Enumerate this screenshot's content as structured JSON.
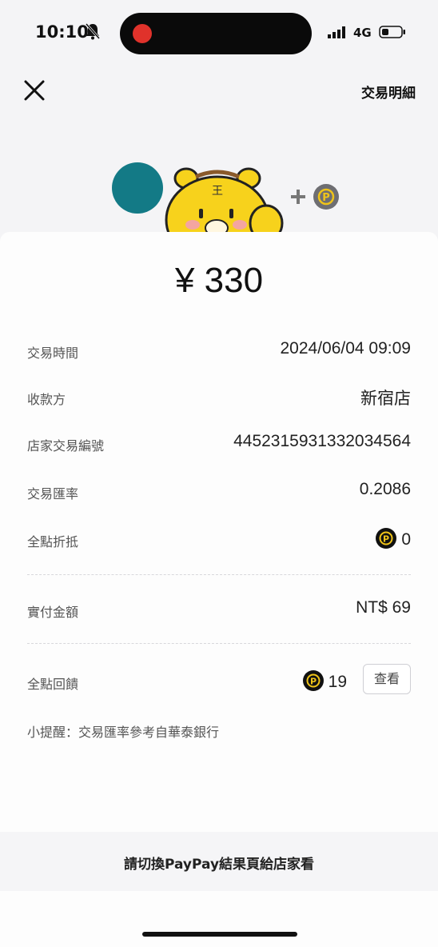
{
  "status_bar": {
    "time": "10:10",
    "network": "4G",
    "icons": [
      "bell-slash-icon",
      "signal-icon",
      "battery-icon"
    ]
  },
  "header": {
    "detail_link": "交易明細",
    "close_icon": "close-icon"
  },
  "payment": {
    "amount": "¥ 330"
  },
  "details": {
    "time_label": "交易時間",
    "time_value": "2024/06/04 09:09",
    "payee_label": "收款方",
    "payee_value": "新宿店",
    "txn_label": "店家交易編號",
    "txn_value": "4452315931332034564",
    "rate_label": "交易匯率",
    "rate_value": "0.2086",
    "points_label": "全點折抵",
    "points_value": "0",
    "paid_label": "實付金額",
    "paid_value": "NT$ 69",
    "reward_label": "全點回饋",
    "reward_value": "19",
    "view_button": "查看"
  },
  "note": "小提醒：交易匯率參考自華泰銀行",
  "footer": {
    "text": "請切換PayPay結果頁給店家看"
  },
  "colors": {
    "merchant_avatar": "#137a86",
    "point_coin": "#111111",
    "point_coin_mark": "#f0c419",
    "mascot_yellow": "#f7d21c"
  }
}
